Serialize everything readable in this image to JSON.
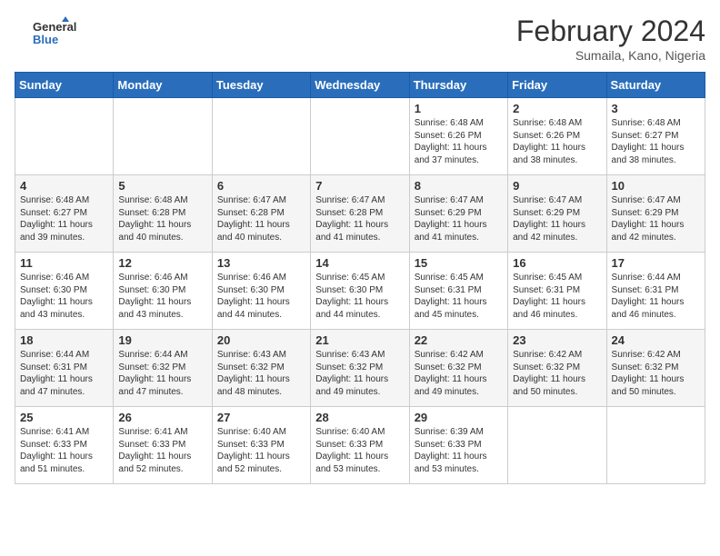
{
  "header": {
    "logo_general": "General",
    "logo_blue": "Blue",
    "title": "February 2024",
    "subtitle": "Sumaila, Kano, Nigeria"
  },
  "days_of_week": [
    "Sunday",
    "Monday",
    "Tuesday",
    "Wednesday",
    "Thursday",
    "Friday",
    "Saturday"
  ],
  "weeks": [
    [
      {
        "day": "",
        "info": ""
      },
      {
        "day": "",
        "info": ""
      },
      {
        "day": "",
        "info": ""
      },
      {
        "day": "",
        "info": ""
      },
      {
        "day": "1",
        "info": "Sunrise: 6:48 AM\nSunset: 6:26 PM\nDaylight: 11 hours and 37 minutes."
      },
      {
        "day": "2",
        "info": "Sunrise: 6:48 AM\nSunset: 6:26 PM\nDaylight: 11 hours and 38 minutes."
      },
      {
        "day": "3",
        "info": "Sunrise: 6:48 AM\nSunset: 6:27 PM\nDaylight: 11 hours and 38 minutes."
      }
    ],
    [
      {
        "day": "4",
        "info": "Sunrise: 6:48 AM\nSunset: 6:27 PM\nDaylight: 11 hours and 39 minutes."
      },
      {
        "day": "5",
        "info": "Sunrise: 6:48 AM\nSunset: 6:28 PM\nDaylight: 11 hours and 40 minutes."
      },
      {
        "day": "6",
        "info": "Sunrise: 6:47 AM\nSunset: 6:28 PM\nDaylight: 11 hours and 40 minutes."
      },
      {
        "day": "7",
        "info": "Sunrise: 6:47 AM\nSunset: 6:28 PM\nDaylight: 11 hours and 41 minutes."
      },
      {
        "day": "8",
        "info": "Sunrise: 6:47 AM\nSunset: 6:29 PM\nDaylight: 11 hours and 41 minutes."
      },
      {
        "day": "9",
        "info": "Sunrise: 6:47 AM\nSunset: 6:29 PM\nDaylight: 11 hours and 42 minutes."
      },
      {
        "day": "10",
        "info": "Sunrise: 6:47 AM\nSunset: 6:29 PM\nDaylight: 11 hours and 42 minutes."
      }
    ],
    [
      {
        "day": "11",
        "info": "Sunrise: 6:46 AM\nSunset: 6:30 PM\nDaylight: 11 hours and 43 minutes."
      },
      {
        "day": "12",
        "info": "Sunrise: 6:46 AM\nSunset: 6:30 PM\nDaylight: 11 hours and 43 minutes."
      },
      {
        "day": "13",
        "info": "Sunrise: 6:46 AM\nSunset: 6:30 PM\nDaylight: 11 hours and 44 minutes."
      },
      {
        "day": "14",
        "info": "Sunrise: 6:45 AM\nSunset: 6:30 PM\nDaylight: 11 hours and 44 minutes."
      },
      {
        "day": "15",
        "info": "Sunrise: 6:45 AM\nSunset: 6:31 PM\nDaylight: 11 hours and 45 minutes."
      },
      {
        "day": "16",
        "info": "Sunrise: 6:45 AM\nSunset: 6:31 PM\nDaylight: 11 hours and 46 minutes."
      },
      {
        "day": "17",
        "info": "Sunrise: 6:44 AM\nSunset: 6:31 PM\nDaylight: 11 hours and 46 minutes."
      }
    ],
    [
      {
        "day": "18",
        "info": "Sunrise: 6:44 AM\nSunset: 6:31 PM\nDaylight: 11 hours and 47 minutes."
      },
      {
        "day": "19",
        "info": "Sunrise: 6:44 AM\nSunset: 6:32 PM\nDaylight: 11 hours and 47 minutes."
      },
      {
        "day": "20",
        "info": "Sunrise: 6:43 AM\nSunset: 6:32 PM\nDaylight: 11 hours and 48 minutes."
      },
      {
        "day": "21",
        "info": "Sunrise: 6:43 AM\nSunset: 6:32 PM\nDaylight: 11 hours and 49 minutes."
      },
      {
        "day": "22",
        "info": "Sunrise: 6:42 AM\nSunset: 6:32 PM\nDaylight: 11 hours and 49 minutes."
      },
      {
        "day": "23",
        "info": "Sunrise: 6:42 AM\nSunset: 6:32 PM\nDaylight: 11 hours and 50 minutes."
      },
      {
        "day": "24",
        "info": "Sunrise: 6:42 AM\nSunset: 6:32 PM\nDaylight: 11 hours and 50 minutes."
      }
    ],
    [
      {
        "day": "25",
        "info": "Sunrise: 6:41 AM\nSunset: 6:33 PM\nDaylight: 11 hours and 51 minutes."
      },
      {
        "day": "26",
        "info": "Sunrise: 6:41 AM\nSunset: 6:33 PM\nDaylight: 11 hours and 52 minutes."
      },
      {
        "day": "27",
        "info": "Sunrise: 6:40 AM\nSunset: 6:33 PM\nDaylight: 11 hours and 52 minutes."
      },
      {
        "day": "28",
        "info": "Sunrise: 6:40 AM\nSunset: 6:33 PM\nDaylight: 11 hours and 53 minutes."
      },
      {
        "day": "29",
        "info": "Sunrise: 6:39 AM\nSunset: 6:33 PM\nDaylight: 11 hours and 53 minutes."
      },
      {
        "day": "",
        "info": ""
      },
      {
        "day": "",
        "info": ""
      }
    ]
  ]
}
